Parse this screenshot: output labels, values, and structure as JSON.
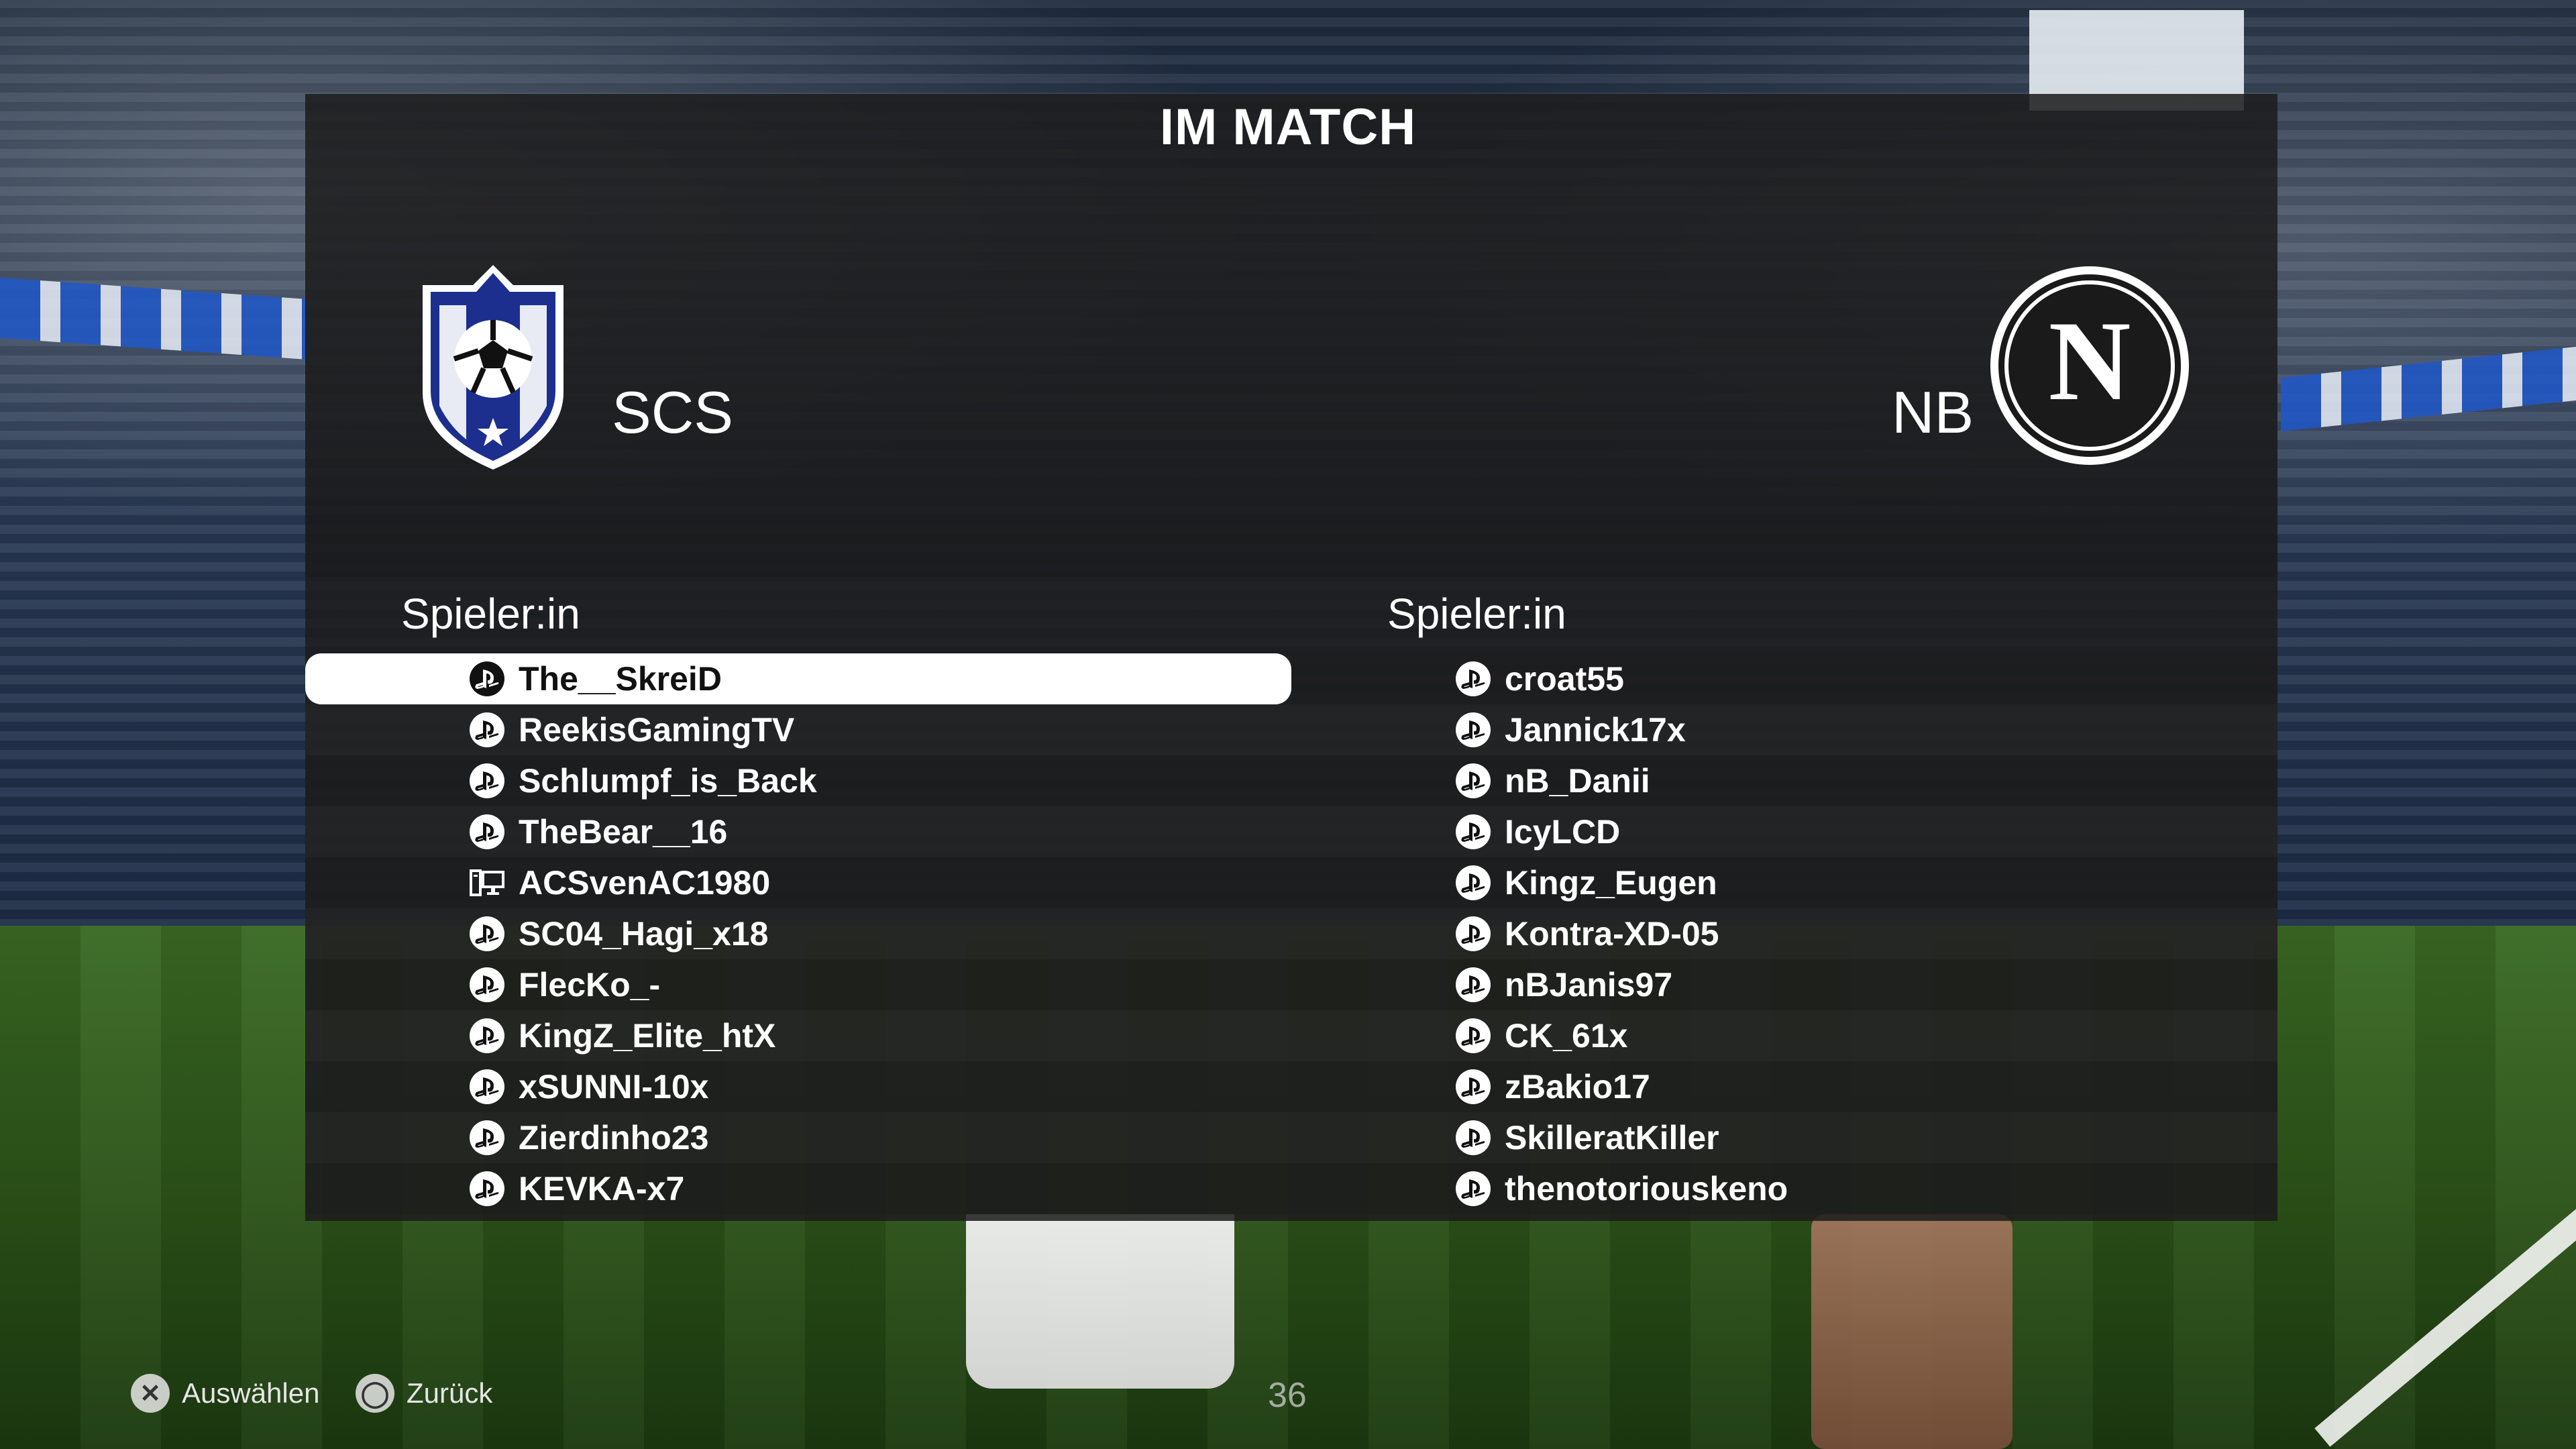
{
  "header": {
    "title": "IM MATCH"
  },
  "teams": {
    "home": {
      "abbr": "SCS",
      "column_label": "Spieler:in"
    },
    "away": {
      "abbr": "NB",
      "column_label": "Spieler:in",
      "crest_letter": "N"
    }
  },
  "home_players": [
    {
      "name": "The__SkreiD",
      "platform": "playstation-icon",
      "selected": true
    },
    {
      "name": "ReekisGamingTV",
      "platform": "playstation-icon"
    },
    {
      "name": "Schlumpf_is_Back",
      "platform": "playstation-icon"
    },
    {
      "name": "TheBear__16",
      "platform": "playstation-icon"
    },
    {
      "name": "ACSvenAC1980",
      "platform": "pc-icon"
    },
    {
      "name": "SC04_Hagi_x18",
      "platform": "playstation-icon"
    },
    {
      "name": "FlecKo_-",
      "platform": "playstation-icon"
    },
    {
      "name": "KingZ_Elite_htX",
      "platform": "playstation-icon"
    },
    {
      "name": "xSUNNI-10x",
      "platform": "playstation-icon"
    },
    {
      "name": "Zierdinho23",
      "platform": "playstation-icon"
    },
    {
      "name": "KEVKA-x7",
      "platform": "playstation-icon"
    }
  ],
  "away_players": [
    {
      "name": "croat55",
      "platform": "playstation-icon"
    },
    {
      "name": "Jannick17x",
      "platform": "playstation-icon"
    },
    {
      "name": "nB_Danii",
      "platform": "playstation-icon"
    },
    {
      "name": "IcyLCD",
      "platform": "playstation-icon"
    },
    {
      "name": "Kingz_Eugen",
      "platform": "playstation-icon"
    },
    {
      "name": "Kontra-XD-05",
      "platform": "playstation-icon"
    },
    {
      "name": "nBJanis97",
      "platform": "playstation-icon"
    },
    {
      "name": "CK_61x",
      "platform": "playstation-icon"
    },
    {
      "name": "zBakio17",
      "platform": "playstation-icon"
    },
    {
      "name": "SkilleratKiller",
      "platform": "playstation-icon"
    },
    {
      "name": "thenotoriouskeno",
      "platform": "playstation-icon"
    }
  ],
  "footer": {
    "select_label": "Auswählen",
    "select_icon": "cross-button-icon",
    "back_label": "Zurück",
    "back_icon": "circle-button-icon",
    "timer": "36"
  },
  "colors": {
    "highlight": "#ffffff",
    "panel": "#1c1c1c",
    "home_crest": "#1c2f8f"
  }
}
